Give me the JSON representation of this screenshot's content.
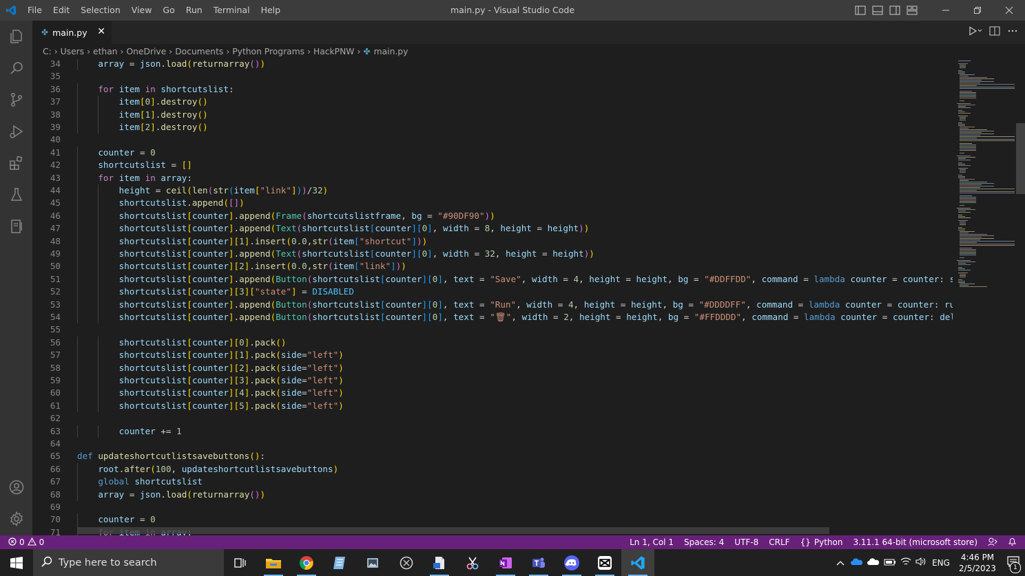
{
  "window": {
    "title": "main.py - Visual Studio Code"
  },
  "menu": [
    "File",
    "Edit",
    "Selection",
    "View",
    "Go",
    "Run",
    "Terminal",
    "Help"
  ],
  "tab": {
    "filename": "main.py",
    "close_glyph": "✕"
  },
  "breadcrumb": [
    "C:",
    "Users",
    "ethan",
    "OneDrive",
    "Documents",
    "Python Programs",
    "HackPNW",
    "main.py"
  ],
  "colors": {
    "statusbar": "#68217a",
    "editor_bg": "#1e1e1e",
    "activitybar": "#333333",
    "titlebar": "#3c3c3c",
    "keyword": "#569cd6",
    "control": "#c586c0",
    "function": "#dcdcaa",
    "variable": "#9cdcfe",
    "string": "#ce9178",
    "number": "#b5cea8"
  },
  "code": {
    "lines": [
      {
        "n": "34",
        "text": "    array = json.load(returnarray())"
      },
      {
        "n": "35",
        "text": ""
      },
      {
        "n": "36",
        "text": "    for item in shortcutslist:"
      },
      {
        "n": "37",
        "text": "        item[0].destroy()"
      },
      {
        "n": "38",
        "text": "        item[1].destroy()"
      },
      {
        "n": "39",
        "text": "        item[2].destroy()"
      },
      {
        "n": "40",
        "text": ""
      },
      {
        "n": "41",
        "text": "    counter = 0"
      },
      {
        "n": "42",
        "text": "    shortcutslist = []"
      },
      {
        "n": "43",
        "text": "    for item in array:"
      },
      {
        "n": "44",
        "text": "        height = ceil(len(str(item[\"link\"]))/32)"
      },
      {
        "n": "45",
        "text": "        shortcutslist.append([])"
      },
      {
        "n": "46",
        "text": "        shortcutslist[counter].append(Frame(shortcutslistframe, bg = \"#90DF90\"))"
      },
      {
        "n": "47",
        "text": "        shortcutslist[counter].append(Text(shortcutslist[counter][0], width = 8, height = height))"
      },
      {
        "n": "48",
        "text": "        shortcutslist[counter][1].insert(0.0,str(item[\"shortcut\"]))"
      },
      {
        "n": "49",
        "text": "        shortcutslist[counter].append(Text(shortcutslist[counter][0], width = 32, height = height))"
      },
      {
        "n": "50",
        "text": "        shortcutslist[counter][2].insert(0.0,str(item[\"link\"]))"
      },
      {
        "n": "51",
        "text": "        shortcutslist[counter].append(Button(shortcutslist[counter][0], text = \"Save\", width = 4, height = height, bg = \"#DDFFDD\", command = lambda counter = counter: sav"
      },
      {
        "n": "52",
        "text": "        shortcutslist[counter][3][\"state\"] = DISABLED"
      },
      {
        "n": "53",
        "text": "        shortcutslist[counter].append(Button(shortcutslist[counter][0], text = \"Run\", width = 4, height = height, bg = \"#DDDDFF\", command = lambda counter = counter: runsl"
      },
      {
        "n": "54",
        "text": "        shortcutslist[counter].append(Button(shortcutslist[counter][0], text = \"🗑\", width = 2, height = height, bg = \"#FFDDDD\", command = lambda counter = counter: delete"
      },
      {
        "n": "55",
        "text": ""
      },
      {
        "n": "56",
        "text": "        shortcutslist[counter][0].pack()"
      },
      {
        "n": "57",
        "text": "        shortcutslist[counter][1].pack(side=\"left\")"
      },
      {
        "n": "58",
        "text": "        shortcutslist[counter][2].pack(side=\"left\")"
      },
      {
        "n": "59",
        "text": "        shortcutslist[counter][3].pack(side=\"left\")"
      },
      {
        "n": "60",
        "text": "        shortcutslist[counter][4].pack(side=\"left\")"
      },
      {
        "n": "61",
        "text": "        shortcutslist[counter][5].pack(side=\"left\")"
      },
      {
        "n": "62",
        "text": ""
      },
      {
        "n": "63",
        "text": "        counter += 1"
      },
      {
        "n": "64",
        "text": ""
      },
      {
        "n": "65",
        "text": "def updateshortcutlistsavebuttons():"
      },
      {
        "n": "66",
        "text": "    root.after(100, updateshortcutlistsavebuttons)"
      },
      {
        "n": "67",
        "text": "    global shortcutslist"
      },
      {
        "n": "68",
        "text": "    array = json.load(returnarray())"
      },
      {
        "n": "69",
        "text": ""
      },
      {
        "n": "70",
        "text": "    counter = 0"
      },
      {
        "n": "71",
        "text": "    for item in array:"
      }
    ]
  },
  "statusbar": {
    "errors": "0",
    "warnings": "0",
    "position": "Ln 1, Col 1",
    "spaces": "Spaces: 4",
    "encoding": "UTF-8",
    "eol": "CRLF",
    "language": "Python",
    "interpreter": "3.11.1 64-bit (microsoft store)"
  },
  "taskbar": {
    "search_placeholder": "Type here to search",
    "language": "ENG",
    "time": "4:46 PM",
    "date": "2/5/2023",
    "notification_count": "1"
  }
}
